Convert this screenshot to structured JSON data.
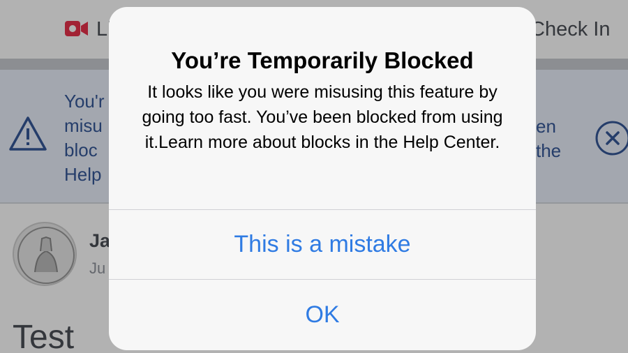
{
  "toolbar": {
    "live_label": "Live",
    "checkin_label": "Check In",
    "live_icon": "video-camera-icon"
  },
  "notice": {
    "text_left": [
      "You'r",
      "misu",
      "bloc",
      "Help"
    ],
    "text_right": [
      "en",
      "the"
    ],
    "warning_icon": "warning-triangle-icon",
    "dismiss_icon": "close-circle-icon",
    "accent_color": "#365899"
  },
  "post": {
    "author": "Ja",
    "date": "Ju",
    "body": "Test",
    "avatar_icon": "profile-avatar-icon"
  },
  "alert": {
    "title": "You’re Temporarily Blocked",
    "message": "It looks like you were misusing this feature by going too fast. You’ve been blocked from using it.Learn more about blocks in the Help Center.",
    "primary_button": "This is a mistake",
    "secondary_button": "OK",
    "button_color": "#2f7be3"
  }
}
